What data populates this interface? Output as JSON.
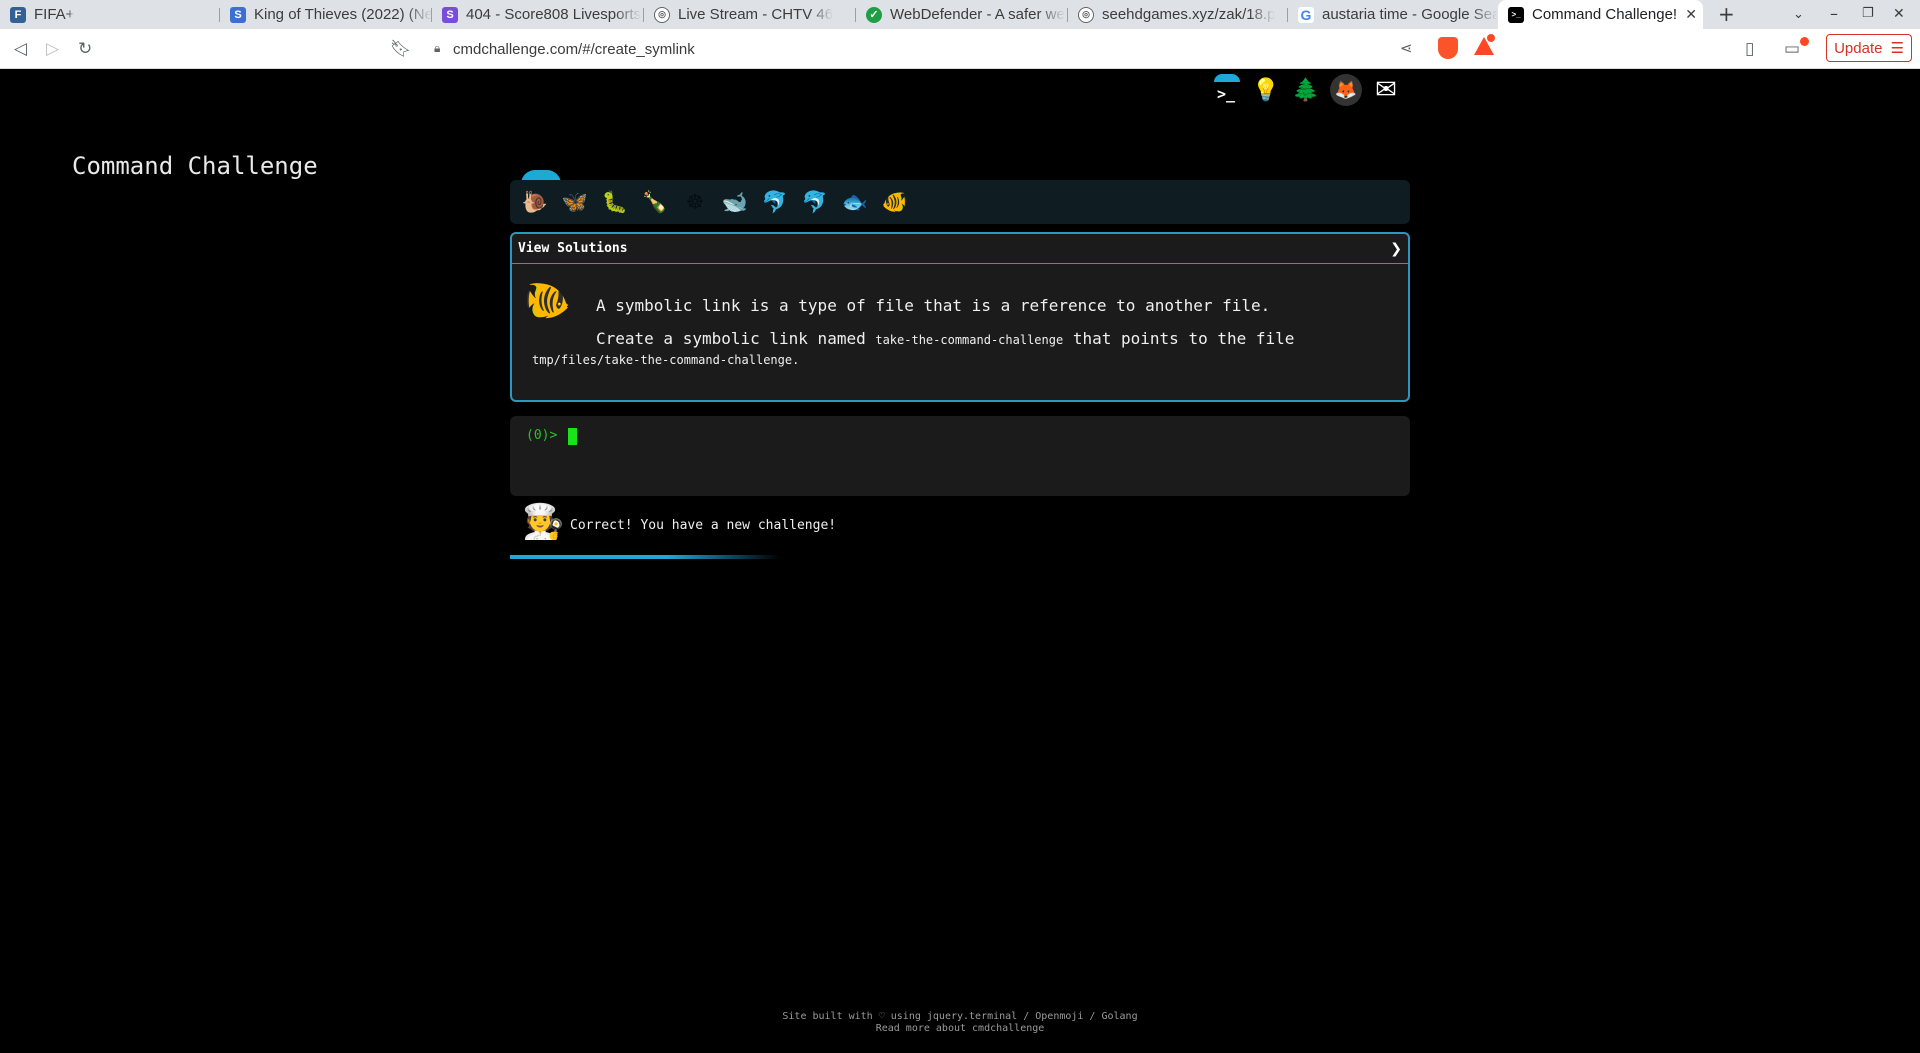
{
  "browser": {
    "tabs": [
      {
        "title": "FIFA+",
        "favicon": "F"
      },
      {
        "title": "King of Thieves (2022) (Ne",
        "favicon": "S"
      },
      {
        "title": "404 - Score808 Livesports",
        "favicon": "S"
      },
      {
        "title": "Live Stream - CHTV 46",
        "favicon": "globe"
      },
      {
        "title": "WebDefender - A safer we",
        "favicon": "shield"
      },
      {
        "title": "seehdgames.xyz/zak/18.p",
        "favicon": "globe"
      },
      {
        "title": "austaria time - Google Sea",
        "favicon": "G"
      },
      {
        "title": "Command Challenge!",
        "favicon": ">_"
      }
    ],
    "new_tab": "+",
    "url": "cmdchallenge.com/#/create_symlink",
    "update_label": "Update",
    "update_menu": "☰"
  },
  "page": {
    "top_icons": [
      "terminal-icon",
      "lightbulb-icon",
      "tree-icon",
      "gitlab-icon",
      "mail-icon"
    ],
    "title": "Command Challenge",
    "levels": [
      "snail",
      "butterfly",
      "caterpillar",
      "bottle",
      "wheel",
      "whale",
      "dolphin",
      "dolphin",
      "fish",
      "tropical-fish"
    ],
    "challenge": {
      "header": "View Solutions",
      "arrow": "❯",
      "line1": "A symbolic link is a type of file that is a reference to another file.",
      "line2_pre": "Create a symbolic link named",
      "line2_code": "take-the-command-challenge",
      "line2_post": "that points to the file",
      "line3": "tmp/files/take-the-command-challenge."
    },
    "terminal": {
      "prompt": "(0)>"
    },
    "feedback": "Correct! You have a new challenge!",
    "progress_fraction": 0.5,
    "footer": {
      "line1": "Site built with ♡ using jquery.terminal / Openmoji / Golang",
      "line2": "Read more about cmdchallenge"
    },
    "colors": {
      "accent": "#2a98c0",
      "prompt": "#29c329",
      "cursor": "#19e319",
      "update": "#d93025"
    }
  }
}
